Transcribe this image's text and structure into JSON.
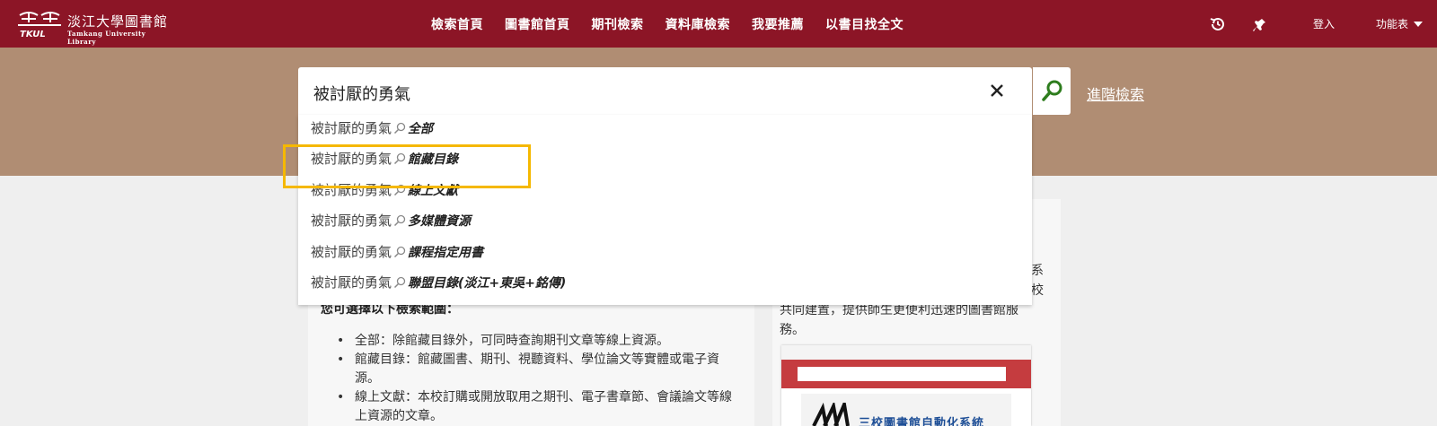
{
  "header": {
    "logo_title": "淡江大學圖書館",
    "logo_subtitle": "Tamkang University Library",
    "logo_mark_text": "TKUL",
    "nav": [
      {
        "label": "檢索首頁"
      },
      {
        "label": "圖書館首頁"
      },
      {
        "label": "期刊檢索"
      },
      {
        "label": "資料庫檢索"
      },
      {
        "label": "我要推薦"
      },
      {
        "label": "以書目找全文"
      }
    ],
    "history_icon": "history-icon",
    "pin_icon": "pin-icon",
    "login_label": "登入",
    "menu_label": "功能表"
  },
  "search": {
    "query": "被討厭的勇氣",
    "clear_icon": "close-icon",
    "submit_icon": "search-icon",
    "advanced_label": "進階檢索"
  },
  "suggestions": [
    {
      "query": "被討厭的勇氣",
      "scope": "全部"
    },
    {
      "query": "被討厭的勇氣",
      "scope": "館藏目錄"
    },
    {
      "query": "被討厭的勇氣",
      "scope": "線上文獻"
    },
    {
      "query": "被討厭的勇氣",
      "scope": "多媒體資源"
    },
    {
      "query": "被討厭的勇氣",
      "scope": "課程指定用書"
    },
    {
      "query": "被討厭的勇氣",
      "scope": "聯盟目錄(淡江+東吳+銘傳)"
    }
  ],
  "highlighted_suggestion_index": 1,
  "content": {
    "scope_heading": "您可選擇以下檢索範圍：",
    "bullets": [
      "全部：除館藏目錄外，可同時查詢期刊文章等線上資源。",
      "館藏目錄：館藏圖書、期刊、視聽資料、學位論文等實體或電子資源。",
      "線上文獻：本校訂購或開放取用之期刊、電子書章節、會議論文等線上資源的文章。"
    ],
    "right_text_line1": "共同建置，提供師生更便利迅速的圖書館服",
    "right_text_line2": "務。",
    "right_edge_1": "系",
    "right_edge_2": "校",
    "thumbnail_label": "三校圖書館自動化系統"
  },
  "colors": {
    "topbar": "#8c1526",
    "band": "#b08d73",
    "highlight": "#f5b800",
    "search_icon": "#2e7d1e"
  }
}
